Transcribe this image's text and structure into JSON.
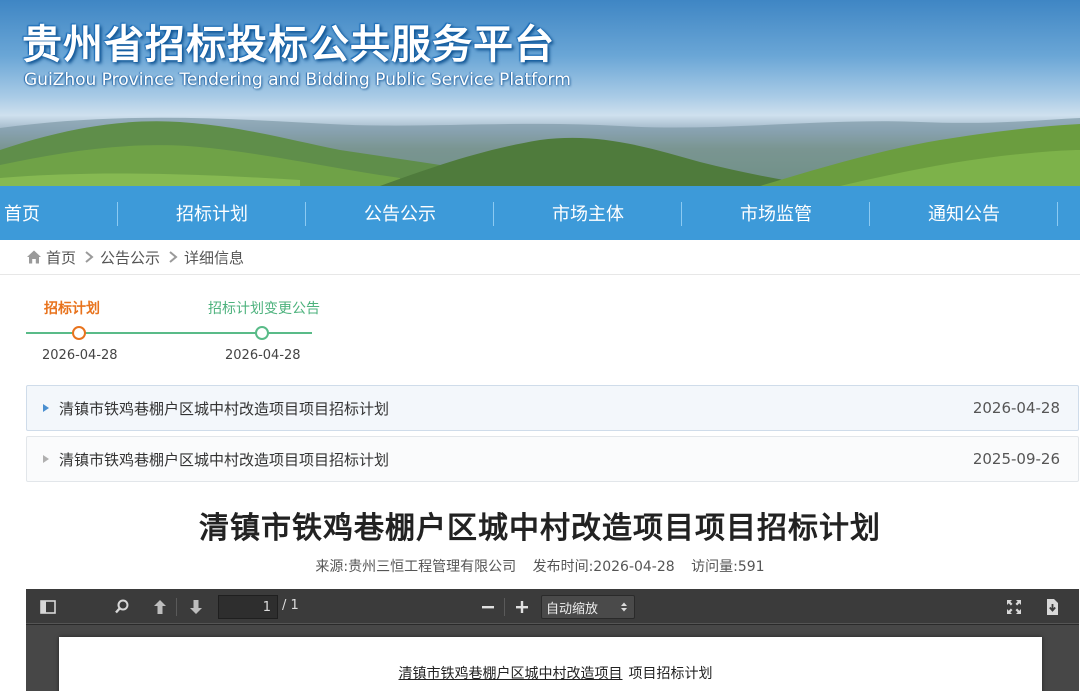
{
  "site": {
    "title": "贵州省招标投标公共服务平台",
    "subtitle": "GuiZhou Province Tendering and Bidding Public Service Platform"
  },
  "nav": {
    "items": [
      {
        "label": "首页"
      },
      {
        "label": "招标计划"
      },
      {
        "label": "公告公示"
      },
      {
        "label": "市场主体"
      },
      {
        "label": "市场监管"
      },
      {
        "label": "通知公告"
      }
    ]
  },
  "breadcrumb": {
    "items": [
      "首页",
      "公告公示",
      "详细信息"
    ]
  },
  "timeline": {
    "steps": [
      {
        "label": "招标计划",
        "date": "2026-04-28",
        "state": "active"
      },
      {
        "label": "招标计划变更公告",
        "date": "2026-04-28",
        "state": "next"
      }
    ]
  },
  "announcements": [
    {
      "title": "清镇市铁鸡巷棚户区城中村改造项目项目招标计划",
      "date": "2026-04-28"
    },
    {
      "title": "清镇市铁鸡巷棚户区城中村改造项目项目招标计划",
      "date": "2025-09-26"
    }
  ],
  "article": {
    "title": "清镇市铁鸡巷棚户区城中村改造项目项目招标计划",
    "source": "来源:贵州三恒工程管理有限公司",
    "publish_time": "发布时间:2026-04-28",
    "views": "访问量:591"
  },
  "pdf_viewer": {
    "page_value": "1",
    "page_total": "/ 1",
    "zoom_selected": "自动缩放",
    "icons": [
      "sidebar-toggle-icon",
      "search-icon",
      "arrow-up-icon",
      "arrow-down-icon",
      "zoom-out-icon",
      "zoom-in-icon",
      "fullscreen-icon",
      "download-icon"
    ],
    "doc_heading_underlined": "清镇市铁鸡巷棚户区城中村改造项目",
    "doc_heading_rest": "项目招标计划"
  },
  "colors": {
    "nav_bg": "#3d9ad9",
    "timeline_active": "#e8731d",
    "timeline_next": "#59bb88",
    "viewer_toolbar": "#3b3b3b"
  }
}
